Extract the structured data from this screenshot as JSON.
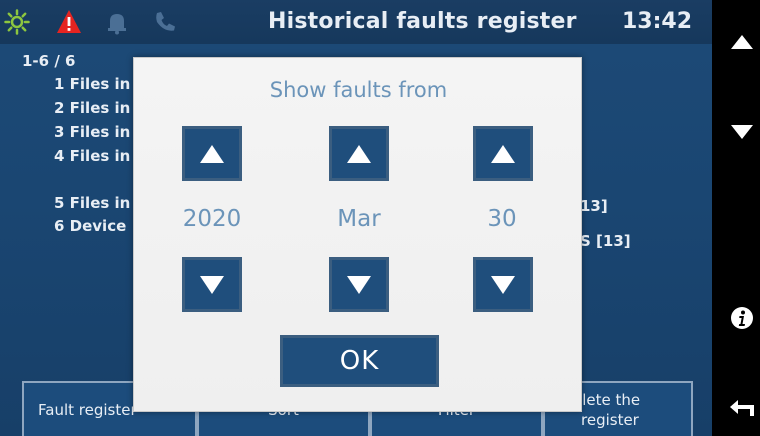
{
  "header": {
    "title": "Historical faults register",
    "clock": "13:42",
    "icons": [
      "sun-icon",
      "warning-icon",
      "bell-icon",
      "phone-icon"
    ],
    "colors": {
      "sun": "#8dc63f",
      "warning": "#e52421",
      "muted": "#4b6f95"
    }
  },
  "list": {
    "counter": "1-6 / 6",
    "items": [
      "1 Files in",
      "2 Files in",
      "3 Files in",
      "4 Files in",
      "5 Files in",
      "6 Device"
    ],
    "right_fragments": [
      "13]",
      "S [13]"
    ]
  },
  "tabs": [
    "Fault register",
    "Sort",
    "Filter",
    "elete the register"
  ],
  "tab_lines": {
    "delete_line1": "elete the",
    "delete_line2": "register"
  },
  "side": [
    "up-arrow-icon",
    "down-arrow-icon",
    "info-icon",
    "back-icon"
  ],
  "dialog": {
    "title": "Show faults from",
    "year": "2020",
    "month": "Mar",
    "day": "30",
    "ok_label": "OK"
  }
}
